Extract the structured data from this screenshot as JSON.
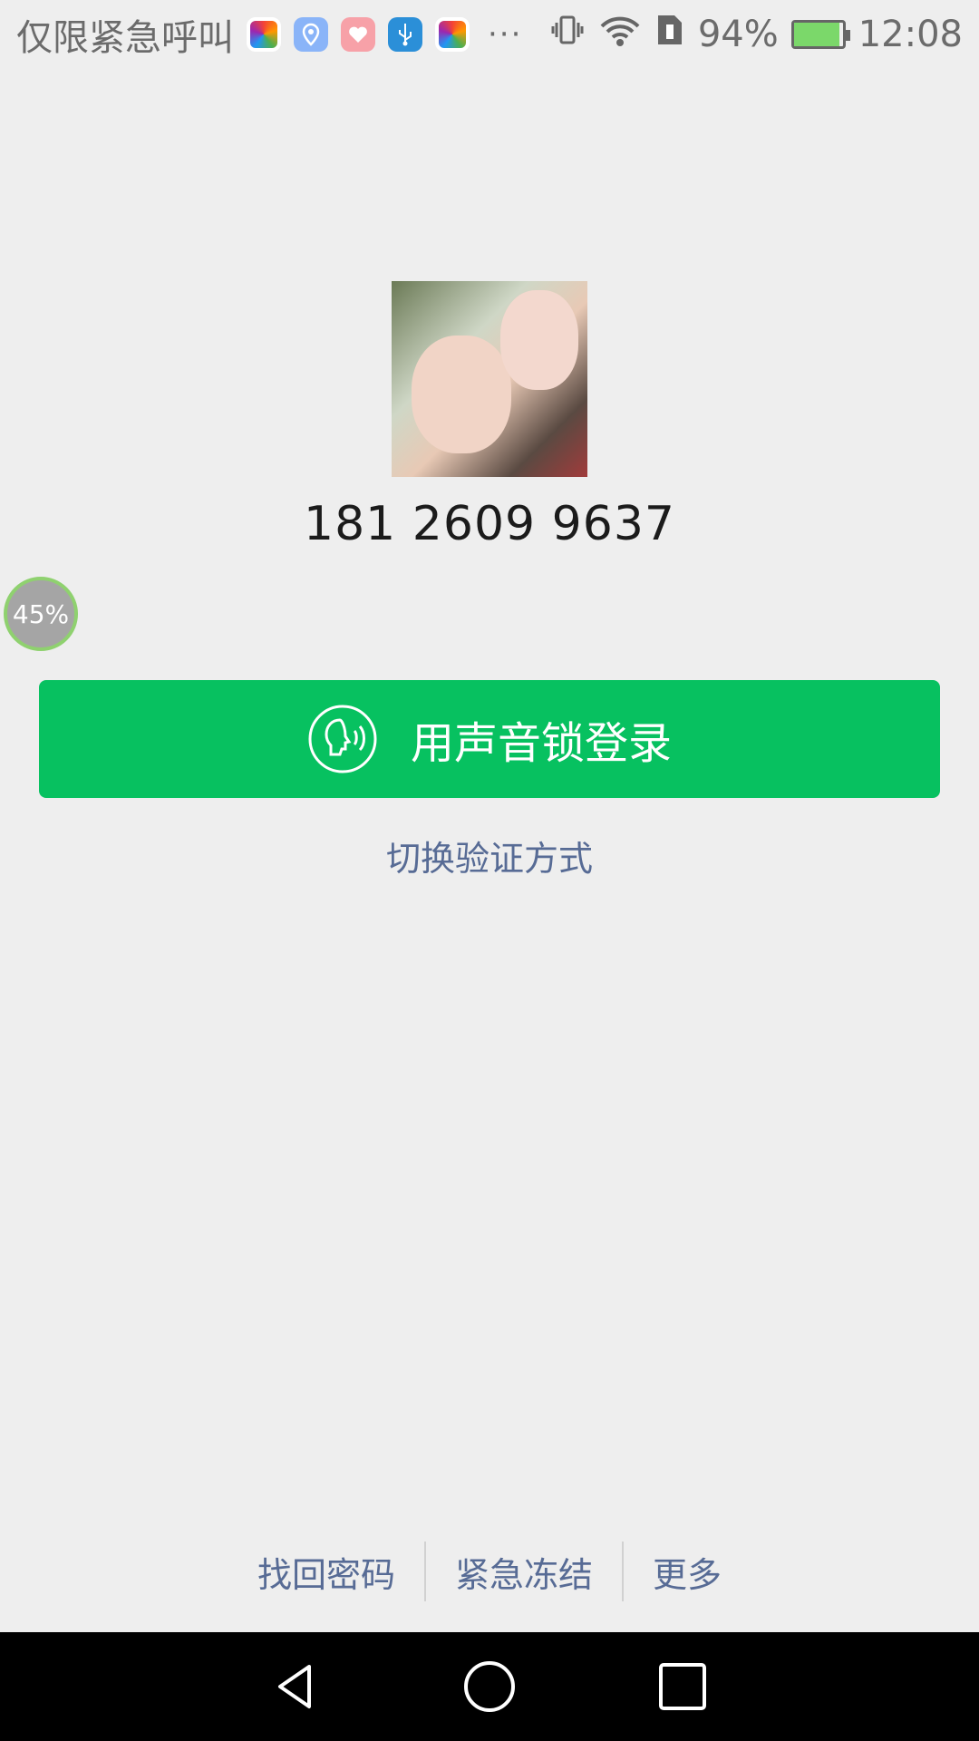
{
  "status_bar": {
    "notice": "仅限紧急呼叫",
    "battery_percent": "94%",
    "time": "12:08",
    "icons": [
      "colorful-app-icon",
      "location-icon",
      "heart-icon",
      "usb-icon",
      "colorful-app-icon",
      "more-icon",
      "vibrate-icon",
      "wifi-icon",
      "sim-icon",
      "battery-icon"
    ]
  },
  "account": {
    "phone": "181 2609 9637"
  },
  "progress": {
    "label": "45%",
    "value": 45
  },
  "primary_action": {
    "label": "用声音锁登录",
    "icon": "voice-profile-icon",
    "color": "#07c160"
  },
  "switch_link": {
    "label": "切换验证方式"
  },
  "bottom_links": {
    "recover_password": "找回密码",
    "emergency_freeze": "紧急冻结",
    "more": "更多"
  },
  "navigation": {
    "back": "back-icon",
    "home": "home-icon",
    "recents": "recents-icon"
  },
  "colors": {
    "background": "#eeeeee",
    "link": "#576b95",
    "primary": "#07c160"
  }
}
